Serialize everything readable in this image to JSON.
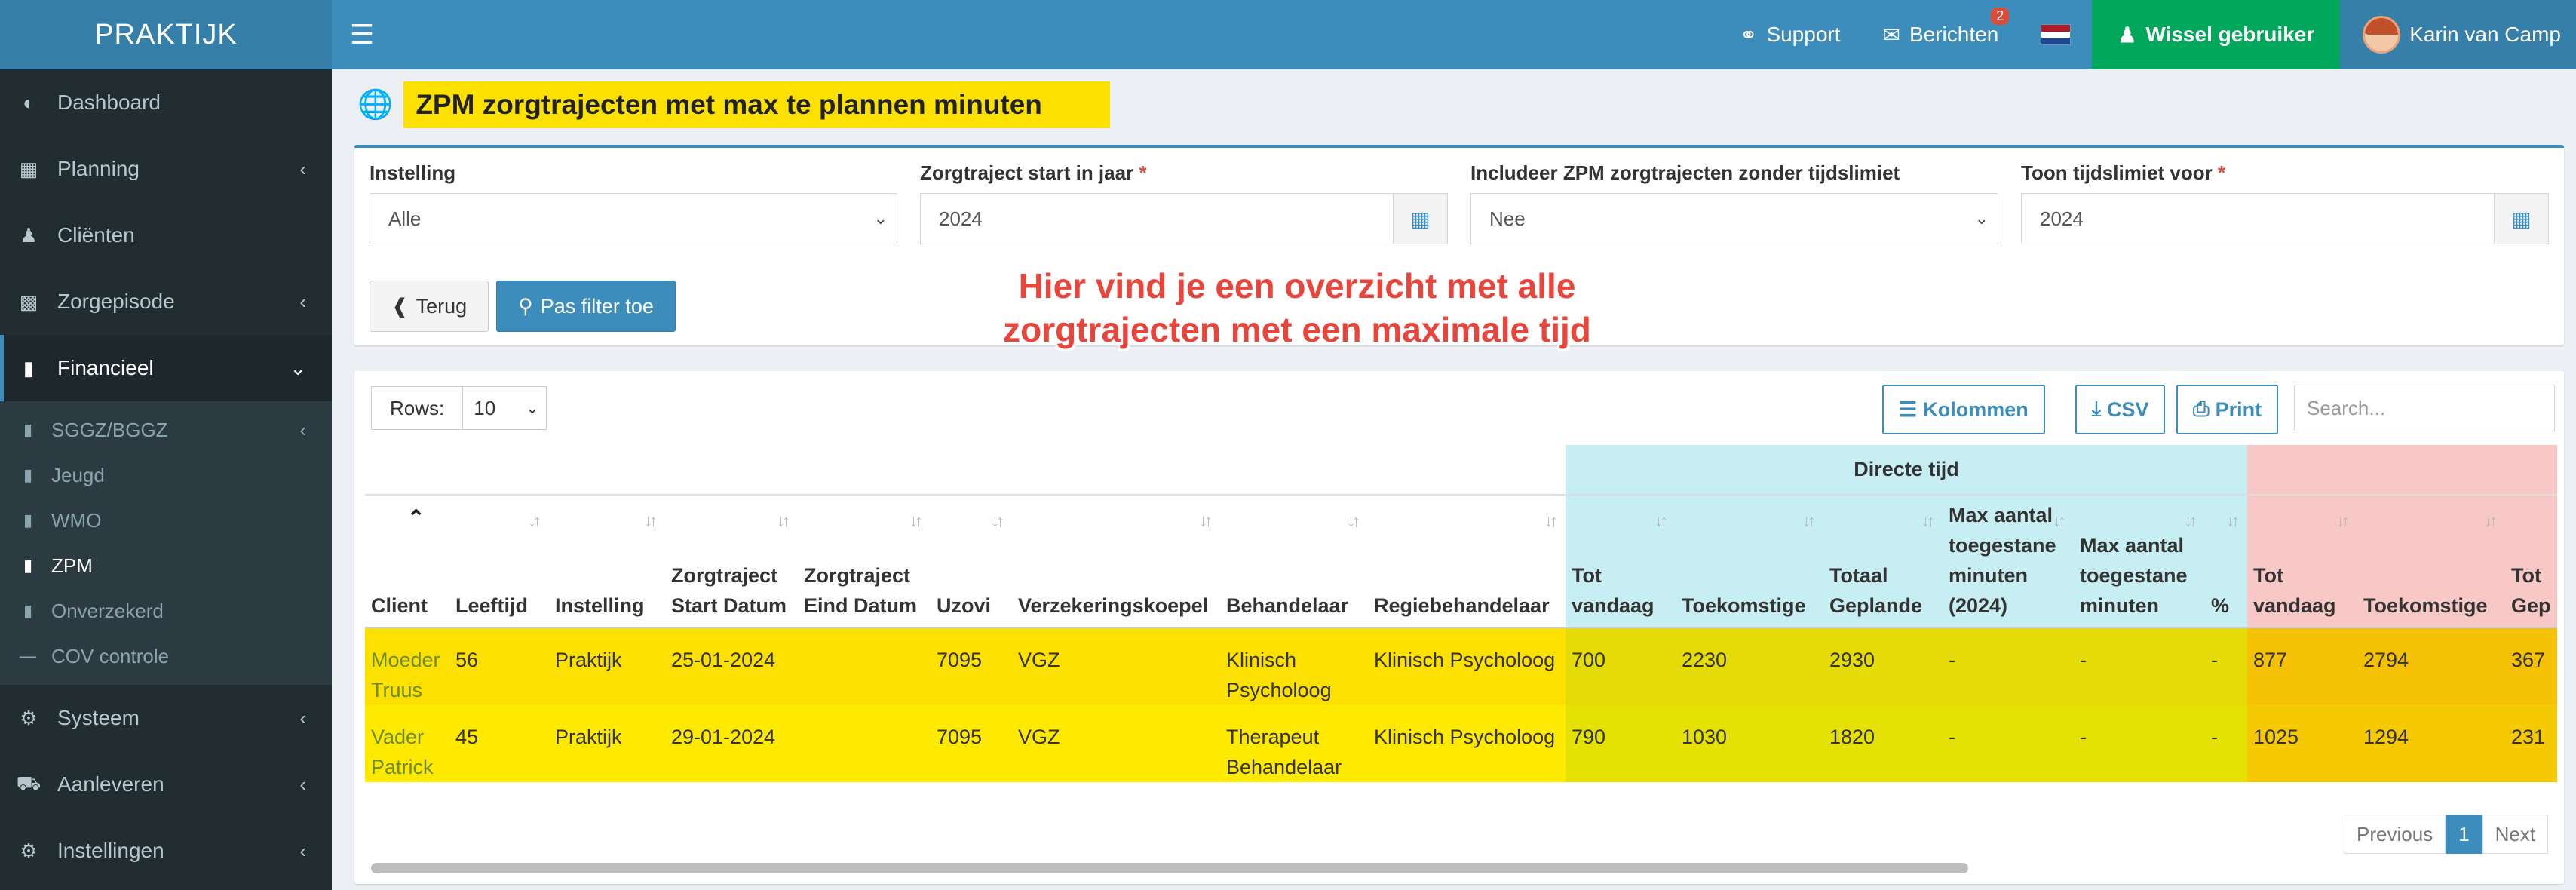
{
  "navbar": {
    "brand": "PRAKTIJK",
    "support": "Support",
    "messages": "Berichten",
    "messages_badge": "2",
    "switch_user": "Wissel gebruiker",
    "user_name": "Karin van Camp",
    "flag_colors": [
      "#ae1c28",
      "#ffffff",
      "#21468b"
    ]
  },
  "sidebar": {
    "items": [
      {
        "label": "Dashboard",
        "icon": "dashboard-icon"
      },
      {
        "label": "Planning",
        "icon": "calendar-icon"
      },
      {
        "label": "Cliënten",
        "icon": "user-icon"
      },
      {
        "label": "Zorgepisode",
        "icon": "briefcase-icon"
      },
      {
        "label": "Financieel",
        "icon": "book-icon"
      }
    ],
    "sub_items": [
      {
        "label": "SGGZ/BGGZ"
      },
      {
        "label": "Jeugd"
      },
      {
        "label": "WMO"
      },
      {
        "label": "ZPM"
      },
      {
        "label": "Onverzekerd"
      },
      {
        "label": "COV controle"
      }
    ],
    "bottom_items": [
      {
        "label": "Systeem",
        "icon": "gears-icon"
      },
      {
        "label": "Aanleveren",
        "icon": "truck-icon"
      },
      {
        "label": "Instellingen",
        "icon": "gear-icon"
      }
    ]
  },
  "page": {
    "title": "ZPM zorgtrajecten met max te plannen minuten"
  },
  "filters": {
    "instelling_label": "Instelling",
    "instelling_value": "Alle",
    "start_label": "Zorgtraject start in jaar",
    "start_value": "2024",
    "include_label": "Includeer ZPM zorgtrajecten zonder tijdslimiet",
    "include_value": "Nee",
    "limit_label": "Toon tijdslimiet voor",
    "limit_value": "2024",
    "required_mark": "*",
    "back_button": "Terug",
    "apply_button": "Pas filter toe"
  },
  "annotation": {
    "line1": "Hier vind je een overzicht met alle",
    "line2": "zorgtrajecten met een maximale tijd"
  },
  "table_tools": {
    "rows_label": "Rows:",
    "rows_value": "10",
    "columns_button": "Kolommen",
    "csv_button": "CSV",
    "print_button": "Print",
    "search_placeholder": "Search..."
  },
  "table": {
    "group_headers": {
      "direct": "Directe tijd"
    },
    "columns": [
      "Client",
      "Leeftijd",
      "Instelling",
      "Zorgtraject Start Datum",
      "Zorgtraject Eind Datum",
      "Uzovi",
      "Verzekeringskoepel",
      "Behandelaar",
      "Regiebehandelaar",
      "Tot vandaag",
      "Toekomstige",
      "Totaal Geplande",
      "Max aantal toegestane minuten (2024)",
      "Max aantal toegestane minuten",
      "%",
      "Tot vandaag",
      "Toekomstige",
      "Tot Gep"
    ],
    "rows": [
      [
        "Moeder Truus",
        "56",
        "Praktijk",
        "25-01-2024",
        "",
        "7095",
        "VGZ",
        "Klinisch Psycholoog",
        "Klinisch Psycholoog",
        "700",
        "2230",
        "2930",
        "-",
        "-",
        "-",
        "877",
        "2794",
        "367"
      ],
      [
        "Vader Patrick",
        "45",
        "Praktijk",
        "29-01-2024",
        "",
        "7095",
        "VGZ",
        "Therapeut Behandelaar",
        "Klinisch Psycholoog",
        "790",
        "1030",
        "1820",
        "-",
        "-",
        "-",
        "1025",
        "1294",
        "231"
      ]
    ]
  },
  "pagination": {
    "previous": "Previous",
    "current": "1",
    "next": "Next"
  }
}
